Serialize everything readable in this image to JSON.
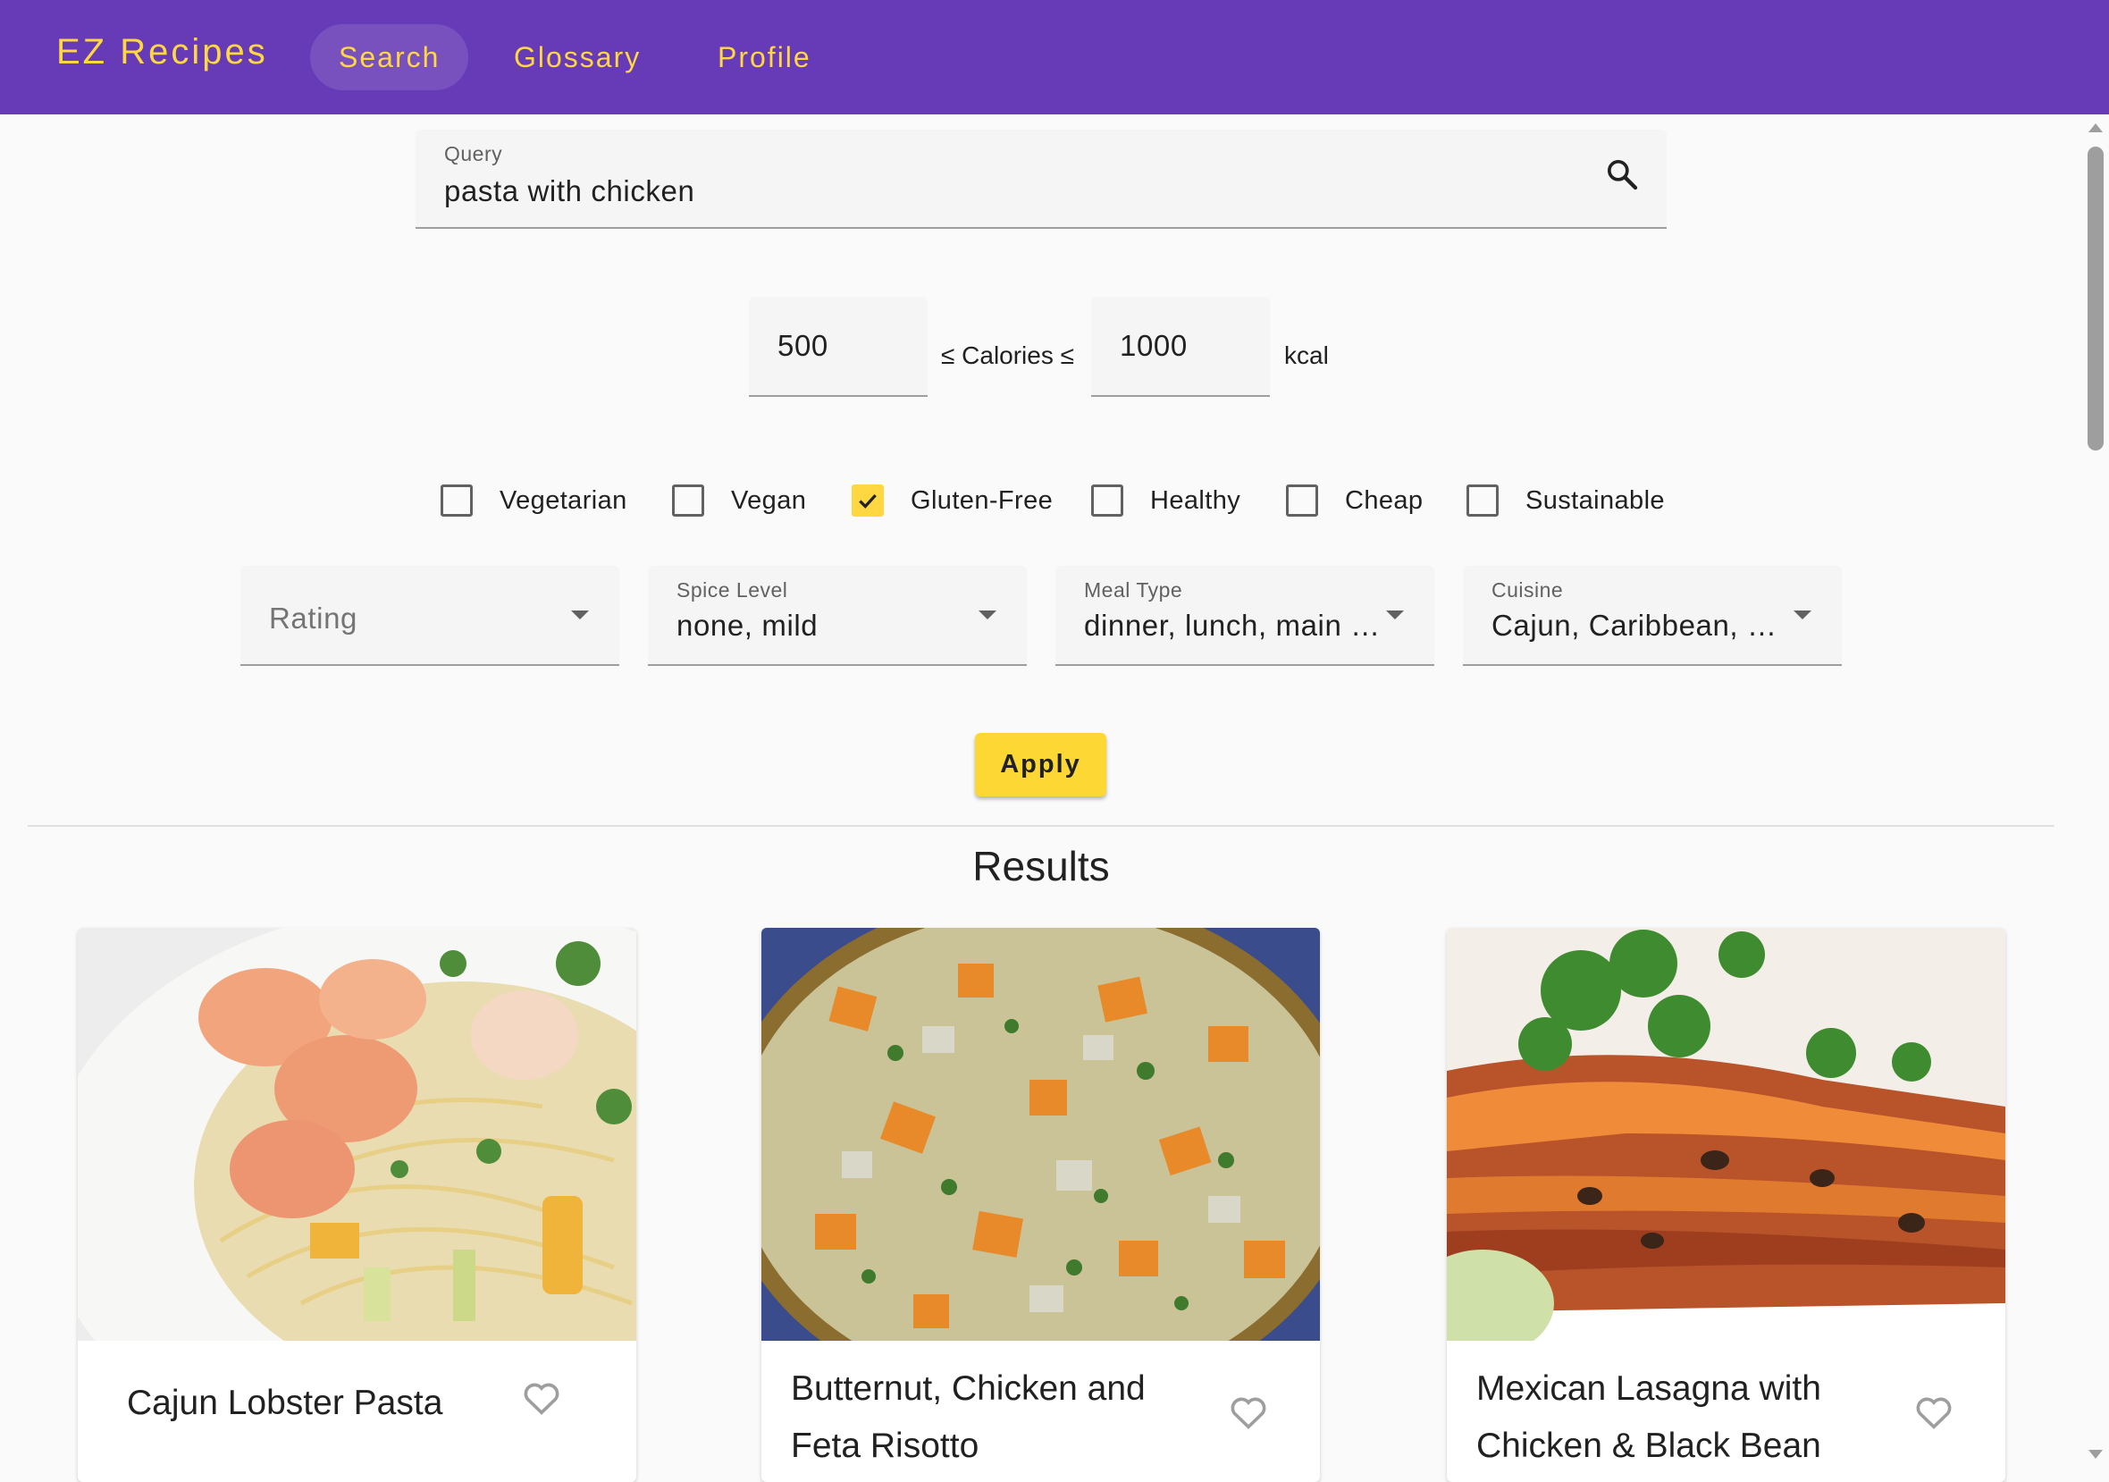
{
  "app": {
    "brand": "EZ Recipes",
    "nav": [
      {
        "label": "Search",
        "active": true
      },
      {
        "label": "Glossary",
        "active": false
      },
      {
        "label": "Profile",
        "active": false
      }
    ],
    "accent_color": "#ffd740",
    "toolbar_color": "#673ab7"
  },
  "search": {
    "label": "Query",
    "value": "pasta with chicken",
    "icon": "search-icon"
  },
  "calories": {
    "min": "500",
    "max": "1000",
    "between_text": "≤ Calories ≤",
    "unit": "kcal"
  },
  "filters": [
    {
      "label": "Vegetarian",
      "checked": false
    },
    {
      "label": "Vegan",
      "checked": false
    },
    {
      "label": "Gluten-Free",
      "checked": true
    },
    {
      "label": "Healthy",
      "checked": false
    },
    {
      "label": "Cheap",
      "checked": false
    },
    {
      "label": "Sustainable",
      "checked": false
    }
  ],
  "selects": {
    "rating": {
      "placeholder": "Rating"
    },
    "spice": {
      "label": "Spice Level",
      "value": "none, mild"
    },
    "meal": {
      "label": "Meal Type",
      "value": "dinner, lunch, main c…"
    },
    "cuisine": {
      "label": "Cuisine",
      "value": "Cajun, Caribbean, Gr…"
    }
  },
  "apply_label": "Apply",
  "results": {
    "title": "Results",
    "cards": [
      {
        "title": "Cajun Lobster Pasta",
        "favorite": false
      },
      {
        "title": "Butternut, Chicken and Feta Risotto",
        "favorite": false
      },
      {
        "title": "Mexican Lasagna with Chicken & Black Bean",
        "favorite": false
      }
    ]
  }
}
